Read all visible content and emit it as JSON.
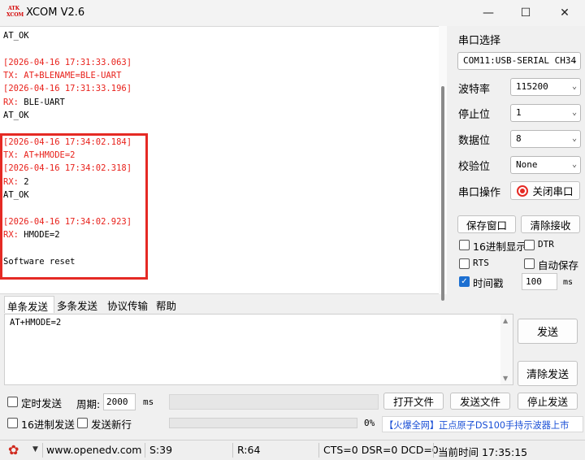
{
  "window": {
    "title": "XCOM V2.6",
    "logo_text": "ATK\nXCOM",
    "minimize_icon": "—",
    "maximize_icon": "☐",
    "close_icon": "✕"
  },
  "receive": {
    "lines": [
      {
        "text": "AT_OK",
        "color": "black"
      },
      {
        "text": "",
        "color": "black"
      },
      {
        "text": "[2026-04-16 17:31:33.063]",
        "color": "red"
      },
      {
        "text": "TX: AT+BLENAME=BLE-UART",
        "color": "red"
      },
      {
        "text": "[2026-04-16 17:31:33.196]",
        "color": "red"
      },
      {
        "text": "RX: BLE-UART",
        "color": "red-black"
      },
      {
        "text": "AT_OK",
        "color": "black"
      },
      {
        "text": "",
        "color": "black"
      },
      {
        "text": "[2026-04-16 17:34:02.184]",
        "color": "red"
      },
      {
        "text": "TX: AT+HMODE=2",
        "color": "red"
      },
      {
        "text": "[2026-04-16 17:34:02.318]",
        "color": "red"
      },
      {
        "text": "RX: 2",
        "color": "red-black"
      },
      {
        "text": "AT_OK",
        "color": "black"
      },
      {
        "text": "",
        "color": "black"
      },
      {
        "text": "[2026-04-16 17:34:02.923]",
        "color": "red"
      },
      {
        "text": "RX: HMODE=2",
        "color": "red-black"
      },
      {
        "text": "",
        "color": "black"
      },
      {
        "text": "Software reset",
        "color": "black"
      }
    ]
  },
  "settings": {
    "port_label": "串口选择",
    "port_value": "COM11:USB-SERIAL CH34",
    "baud_label": "波特率",
    "baud_value": "115200",
    "stop_label": "停止位",
    "stop_value": "1",
    "data_label": "数据位",
    "data_value": "8",
    "parity_label": "校验位",
    "parity_value": "None",
    "op_label": "串口操作",
    "op_button": "关闭串口",
    "save_window": "保存窗口",
    "clear_recv": "清除接收",
    "hex_display": "16进制显示",
    "dtr": "DTR",
    "rts": "RTS",
    "auto_save": "自动保存",
    "timestamp": "时间戳",
    "timestamp_ms": "100",
    "ms_unit": "ms"
  },
  "tabs": [
    "单条发送",
    "多条发送",
    "协议传输",
    "帮助"
  ],
  "send": {
    "text": "AT+HMODE=2",
    "send_button": "发送",
    "clear_send": "清除发送",
    "timed_send": "定时发送",
    "period_label": "周期:",
    "period_value": "2000",
    "period_unit": "ms",
    "open_file": "打开文件",
    "send_file": "发送文件",
    "stop_send": "停止发送",
    "hex_send": "16进制发送",
    "send_newline": "发送新行",
    "progress_text": "0%",
    "ad_text": "【火爆全网】正点原子DS100手持示波器上市"
  },
  "status": {
    "url": "www.openedv.com",
    "s_count": "S:39",
    "r_count": "R:64",
    "lines": "CTS=0 DSR=0 DCD=0",
    "time": "当前时间 17:35:15"
  },
  "colors": {
    "red_text": "#e8211b",
    "highlight_box": "#e52a24",
    "checkbox_on": "#1c6fd1"
  }
}
